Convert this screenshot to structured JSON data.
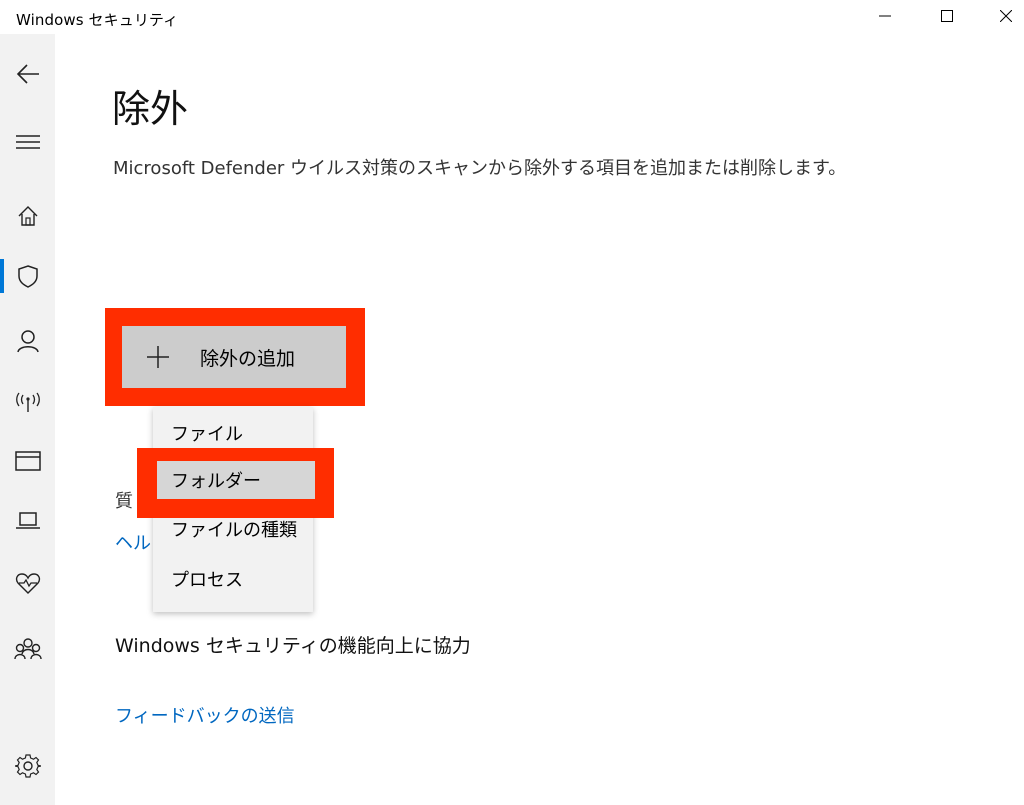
{
  "window": {
    "title": "Windows セキュリティ"
  },
  "sidebar": {
    "items": [
      {
        "icon": "back-arrow-icon"
      },
      {
        "icon": "hamburger-menu-icon"
      },
      {
        "icon": "home-icon"
      },
      {
        "icon": "shield-icon",
        "active": true
      },
      {
        "icon": "person-icon"
      },
      {
        "icon": "wireless-antenna-icon"
      },
      {
        "icon": "app-browser-icon"
      },
      {
        "icon": "laptop-icon"
      },
      {
        "icon": "heart-pulse-icon"
      },
      {
        "icon": "family-icon"
      },
      {
        "icon": "gear-icon"
      }
    ],
    "accent": "#0078d7"
  },
  "main": {
    "title": "除外",
    "description": "Microsoft Defender ウイルス対策のスキャンから除外する項目を追加または削除します。",
    "add_button": {
      "icon": "plus-icon",
      "label": "除外の追加"
    },
    "question_prefix": "質",
    "help_link_prefix": "ヘル"
  },
  "dropdown": {
    "items": [
      {
        "label": "ファイル",
        "selected": false
      },
      {
        "label": "フォルダー",
        "selected": true
      },
      {
        "label": "ファイルの種類",
        "selected": false
      },
      {
        "label": "プロセス",
        "selected": false
      }
    ]
  },
  "feedback": {
    "title": "Windows セキュリティの機能向上に協力",
    "link": "フィードバックの送信"
  },
  "colors": {
    "highlight": "#ff2d00",
    "link": "#0067c0",
    "button_bg": "#cccccc"
  }
}
